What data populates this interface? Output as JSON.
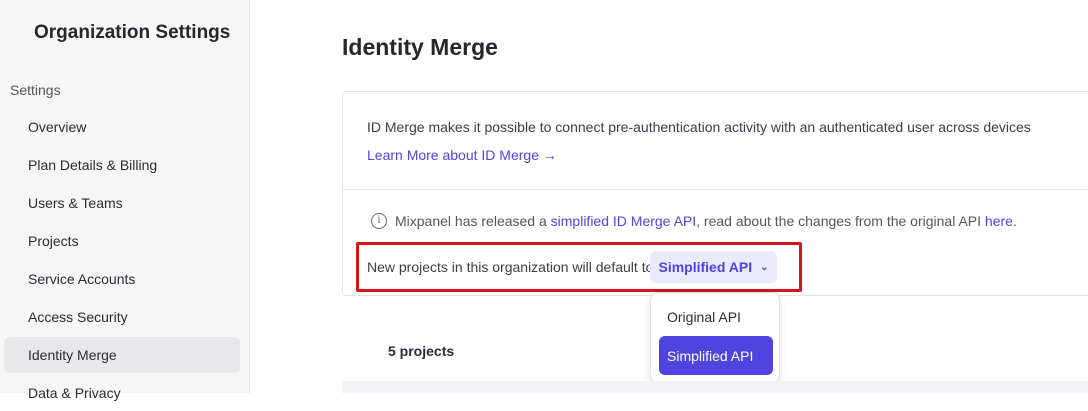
{
  "sidebar": {
    "title": "Organization Settings",
    "section_label": "Settings",
    "items": [
      {
        "label": "Overview"
      },
      {
        "label": "Plan Details & Billing"
      },
      {
        "label": "Users & Teams"
      },
      {
        "label": "Projects"
      },
      {
        "label": "Service Accounts"
      },
      {
        "label": "Access Security"
      },
      {
        "label": "Identity Merge",
        "active": true
      },
      {
        "label": "Data & Privacy"
      }
    ]
  },
  "main": {
    "title": "Identity Merge",
    "description": "ID Merge makes it possible to connect pre-authentication activity with an authenticated user across devices",
    "learn_more": "Learn More about ID Merge →",
    "info": {
      "icon": "info-icon",
      "prefix": "Mixpanel has released a ",
      "link": "simplified ID Merge API",
      "middle": ", read about the changes from the original API ",
      "here": "here",
      "suffix": "."
    },
    "default_label": "New projects in this organization will default to",
    "dropdown": {
      "selected": "Simplified API",
      "options": [
        "Original API",
        "Simplified API"
      ]
    },
    "projects_count": "5 projects"
  },
  "colors": {
    "accent": "#4f44e0",
    "highlight_border": "#d7141a",
    "sidebar_bg": "#f6f6f7"
  }
}
